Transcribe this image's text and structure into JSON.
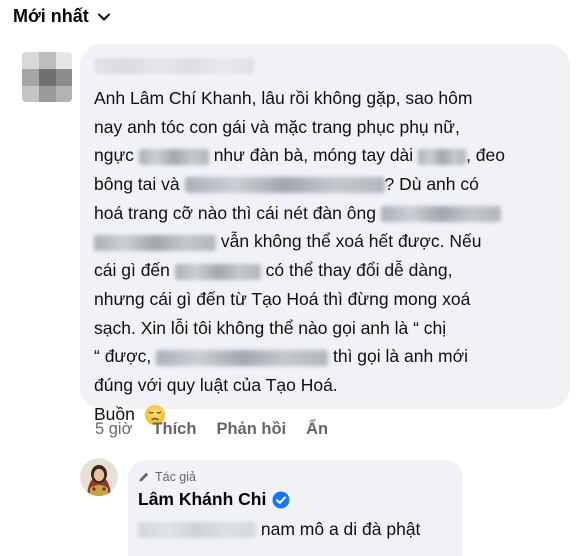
{
  "sort": {
    "label": "Mới nhất",
    "icon": "chevron-down-icon"
  },
  "comment": {
    "lines": [
      [
        "Anh Lâm Chí Khanh, lâu rồi không gặp, sao hôm"
      ],
      [
        "nay anh tóc con gái và mặc trang phục phụ nữ,"
      ],
      [
        "ngực",
        "như đàn bà, móng tay dài",
        ", đeo"
      ],
      [
        "bông tai và",
        "? Dù anh có"
      ],
      [
        "hoá trang cỡ nào thì cái nét đàn ông",
        ""
      ],
      [
        "",
        "vẫn không thể xoá hết được. Nếu"
      ],
      [
        "cái gì đến",
        "có thể thay đổi dễ dàng,"
      ],
      [
        "nhưng cái gì đến từ Tạo Hoá thì đừng mong xoá"
      ],
      [
        "sạch. Xin lỗi tôi không thể nào gọi anh là “ chị"
      ],
      [
        "“ được,",
        "thì gọi là anh mới"
      ],
      [
        "đúng với quy luật của Tạo Hoá."
      ],
      [
        "Buồn"
      ]
    ],
    "emoji": "sad-face-icon"
  },
  "actions": {
    "time": "5 giờ",
    "like": "Thích",
    "reply": "Phản hồi",
    "hide": "Ẩn"
  },
  "reply": {
    "author_badge": "Tác giả",
    "author_icon": "pencil-icon",
    "name": "Lâm Khánh Chi",
    "verified_icon": "verified-badge-icon",
    "text": "nam mô a di đà phật"
  },
  "colors": {
    "bubble": "#f0f2f5",
    "verified": "#1877f2",
    "meta": "#65676b"
  }
}
